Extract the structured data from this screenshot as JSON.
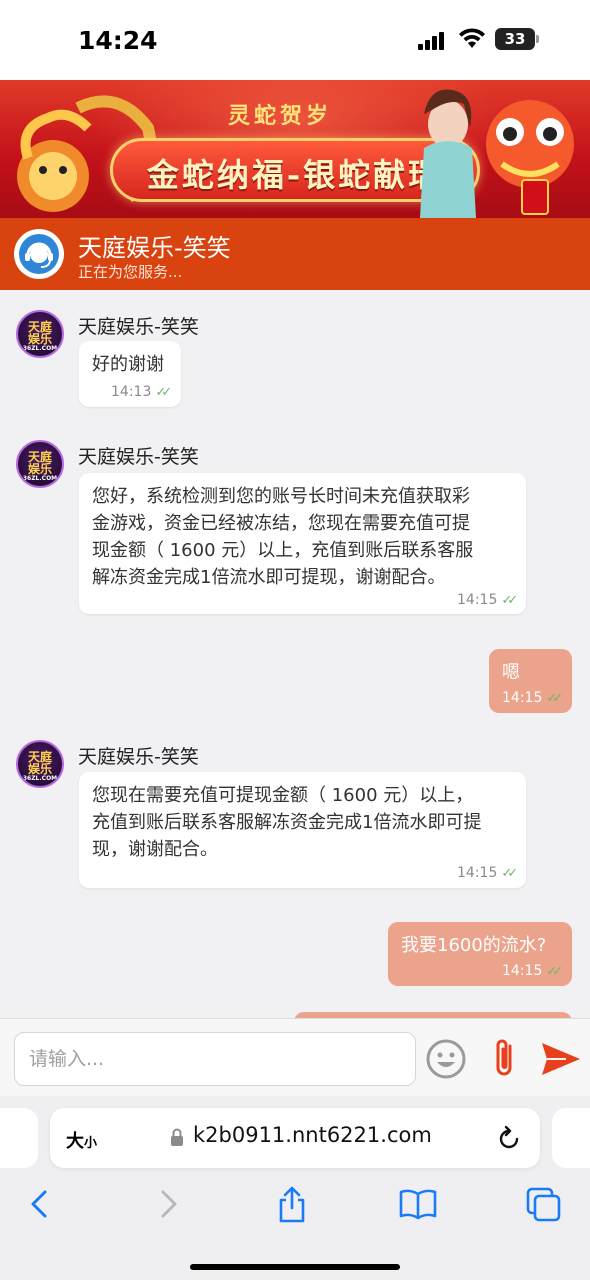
{
  "status_bar": {
    "time": "14:24",
    "battery": "33"
  },
  "banner": {
    "subtitle": "灵蛇贺岁",
    "title": "金蛇纳福-银蛇献瑞"
  },
  "chat_header": {
    "name": "天庭娱乐-笑笑",
    "status": "正在为您服务..."
  },
  "avatar": {
    "line1": "天庭",
    "line2": "娱乐",
    "line3": "36ZL.COM"
  },
  "messages": [
    {
      "direction": "in",
      "sender": "天庭娱乐-笑笑",
      "lines": [
        "好的谢谢"
      ],
      "time": "14:13"
    },
    {
      "direction": "in",
      "sender": "天庭娱乐-笑笑",
      "lines": [
        "您好，系统检测到您的账号长时间未充值获取彩",
        "金游戏，资金已经被冻结，您现在需要充值可提",
        "现金额（ 1600 元）以上，充值到账后联系客服",
        "解冻资金完成1倍流水即可提现，谢谢配合。"
      ],
      "time": "14:15"
    },
    {
      "direction": "out",
      "lines": [
        "嗯"
      ],
      "time": "14:15"
    },
    {
      "direction": "in",
      "sender": "天庭娱乐-笑笑",
      "lines": [
        "您现在需要充值可提现金额（ 1600 元）以上，",
        "充值到账后联系客服解冻资金完成1倍流水即可提",
        "现，谢谢配合。"
      ],
      "time": "14:15"
    },
    {
      "direction": "out",
      "lines": [
        "我要1600的流水?"
      ],
      "time": "14:15"
    }
  ],
  "input": {
    "placeholder": "请输入..."
  },
  "browser": {
    "text_size_big": "大",
    "text_size_small": "小",
    "url": "k2b0911.nnt6221.com"
  },
  "icons": {
    "emoji": "emoji-icon",
    "attach": "paperclip-icon",
    "send": "send-icon",
    "back": "chevron-left-icon",
    "forward": "chevron-right-icon",
    "share": "share-icon",
    "bookmarks": "book-icon",
    "tabs": "tabs-icon",
    "reload": "reload-icon",
    "lock": "lock-icon"
  },
  "colors": {
    "header": "#d9430f",
    "outgoing_bubble": "#eba38c",
    "send": "#e8401c",
    "link_blue": "#1a7cf5"
  }
}
